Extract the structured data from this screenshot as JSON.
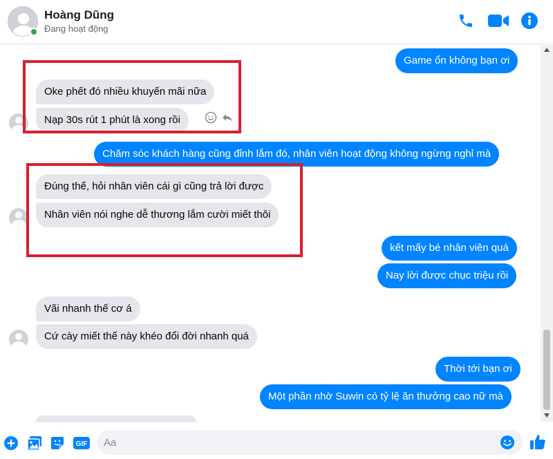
{
  "header": {
    "contact_name": "Hoàng Dũng",
    "contact_status": "Đang hoạt động",
    "accent_color": "#0084ff",
    "online_color": "#31a24c",
    "icons": [
      "phone-icon",
      "video-call-icon",
      "info-icon"
    ]
  },
  "messages": {
    "out_1": "Game ổn không bạn ơi",
    "in_1": "Oke phết đó nhiều khuyến mãi nữa",
    "in_2": "Nạp 30s rút 1 phút là xong rồi",
    "out_2": "Chăm sóc khách hàng cũng đỉnh lắm đó, nhân viên hoạt động không ngừng nghỉ mà",
    "in_3": "Đúng thế, hỏi nhân viên cái gì cũng trả lời được",
    "in_4": "Nhân viên nói nghe dễ thương lắm cười miết thôi",
    "out_3": "kết mấy bé nhân viên quá",
    "out_4": "Nay lời được chục triệu rồi",
    "in_5": "Vãi nhanh thế cơ á",
    "in_6": "Cứ cày miết thế này khéo đổi đời nhanh quá",
    "out_5": "Thời tới bạn ơi",
    "out_6": "Một phần nhờ Suwin có tỷ lệ ăn thưởng cao nữ mà"
  },
  "composer": {
    "placeholder": "Aa",
    "icons": [
      "add-icon",
      "image-icon",
      "sticker-icon",
      "gif-icon",
      "emoji-icon",
      "like-icon"
    ],
    "gif_label": "GIF"
  },
  "highlight_color": "#d6202f"
}
